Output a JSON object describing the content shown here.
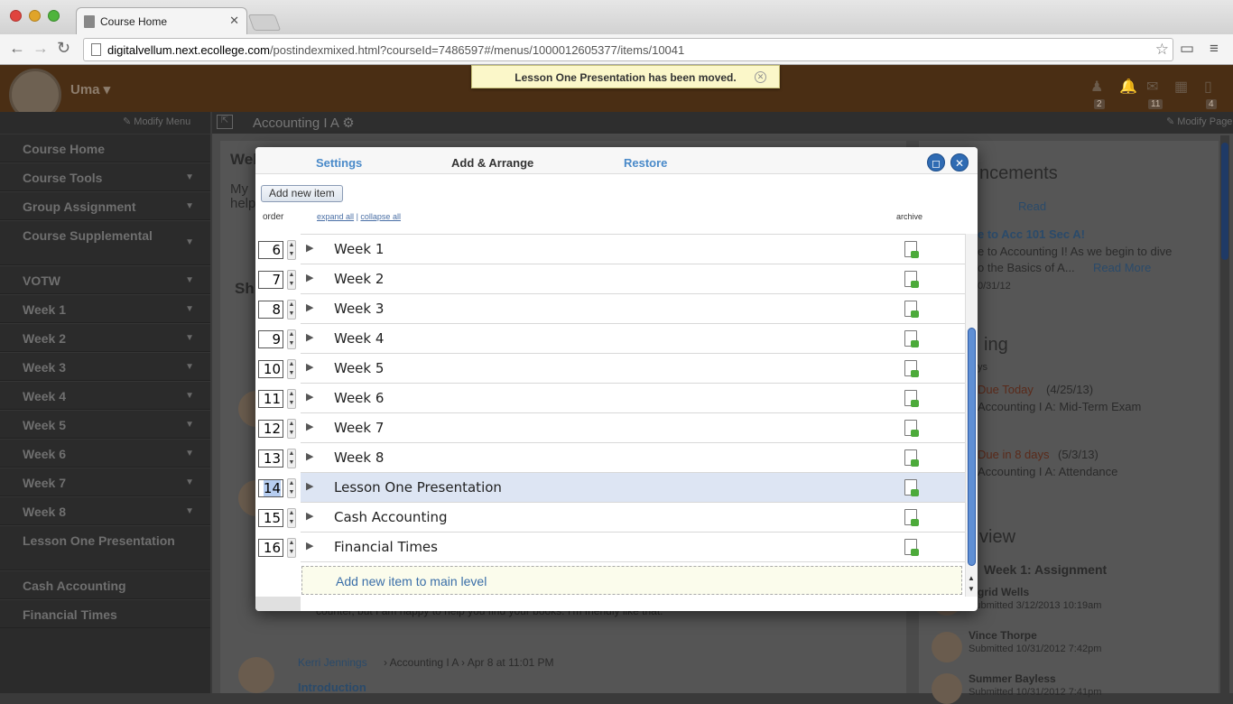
{
  "browser": {
    "tab_title": "Course Home",
    "url_host": "digitalvellum.next.ecollege.com",
    "url_path": "/postindexmixed.html?courseId=7486597#/menus/1000012605377/items/10041"
  },
  "header": {
    "username": "Uma",
    "counts": [
      "2",
      "11",
      "4"
    ],
    "modify_menu": "Modify Menu",
    "modify_page": "Modify Page",
    "course_title": "Accounting I A"
  },
  "notice": {
    "text": "Lesson One Presentation has been moved."
  },
  "sidebar": {
    "items": [
      {
        "label": "Course Home",
        "chev": false
      },
      {
        "label": "Course Tools",
        "chev": true
      },
      {
        "label": "Group Assignment",
        "chev": true
      },
      {
        "label": "Course Supplemental",
        "chev": true
      },
      {
        "label": "VOTW",
        "chev": true
      },
      {
        "label": "Week 1",
        "chev": true
      },
      {
        "label": "Week 2",
        "chev": true
      },
      {
        "label": "Week 3",
        "chev": true
      },
      {
        "label": "Week 4",
        "chev": true
      },
      {
        "label": "Week 5",
        "chev": true
      },
      {
        "label": "Week 6",
        "chev": true
      },
      {
        "label": "Week 7",
        "chev": true
      },
      {
        "label": "Week 8",
        "chev": true
      },
      {
        "label": "Lesson One Presentation",
        "chev": false
      },
      {
        "label": "Cash Accounting",
        "chev": false
      },
      {
        "label": "Financial Times",
        "chev": false
      }
    ]
  },
  "background": {
    "welcome": "Wel",
    "my": "My",
    "help": "help",
    "sh": "Sh",
    "announcements": "ncements",
    "read": "Read",
    "ann_title": "e to Acc 101 Sec A!",
    "ann_body1": "e to Accounting I! As we begin to dive",
    "ann_body2": "o the Basics of A...",
    "read_more": "Read More",
    "ann_date": "0/31/12",
    "upcoming": "ing",
    "days": "ys",
    "due_today": "Due Today",
    "due_today_date": "(4/25/13)",
    "exam": "Accounting I A: Mid-Term Exam",
    "due_8": "Due in 8 days",
    "due_8_date": "(5/3/13)",
    "attendance": "Accounting I A: Attendance",
    "review": "view",
    "assignment": "Week 1: Assignment",
    "s1_name": "grid Wells",
    "s1_sub": "Submitted 3/12/2013 10:19am",
    "s2_name": "Vince Thorpe",
    "s2_sub": "Submitted 10/31/2012 7:42pm",
    "s3_name": "Summer Bayless",
    "s3_sub": "Submitted 10/31/2012 7:41pm",
    "post_text": "counter, but I am happy to help you find your books. I'm friendly like that.",
    "post2_author": "Kerri Jennings",
    "post2_meta": "› Accounting I A › Apr 8 at 11:01 PM",
    "post2_title": "Introduction"
  },
  "modal": {
    "tab_settings": "Settings",
    "tab_add_arrange": "Add & Arrange",
    "tab_restore": "Restore",
    "add_new_item": "Add new item",
    "col_order": "order",
    "expand_all": "expand all",
    "sep": "|",
    "collapse_all": "collapse all",
    "col_archive": "archive",
    "rows": [
      {
        "order": "6",
        "label": "Week 1",
        "selected": false
      },
      {
        "order": "7",
        "label": "Week 2",
        "selected": false
      },
      {
        "order": "8",
        "label": "Week 3",
        "selected": false
      },
      {
        "order": "9",
        "label": "Week 4",
        "selected": false
      },
      {
        "order": "10",
        "label": "Week 5",
        "selected": false
      },
      {
        "order": "11",
        "label": "Week 6",
        "selected": false
      },
      {
        "order": "12",
        "label": "Week 7",
        "selected": false
      },
      {
        "order": "13",
        "label": "Week 8",
        "selected": false
      },
      {
        "order": "14",
        "label": "Lesson One Presentation",
        "selected": true
      },
      {
        "order": "15",
        "label": "Cash Accounting",
        "selected": false
      },
      {
        "order": "16",
        "label": "Financial Times",
        "selected": false
      }
    ],
    "add_main": "Add new item to main level"
  }
}
